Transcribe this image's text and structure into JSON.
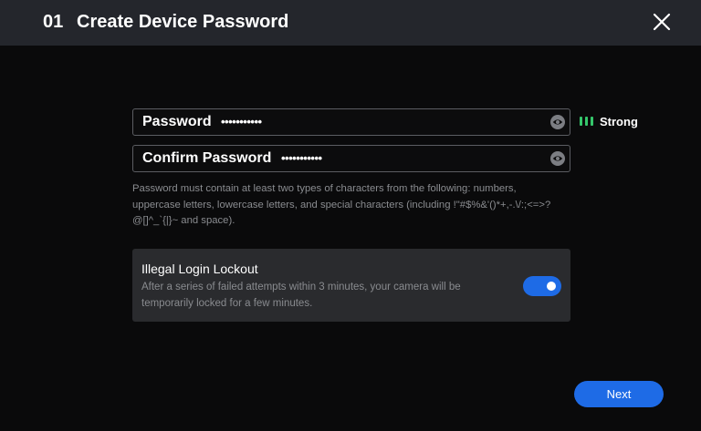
{
  "header": {
    "step": "01",
    "title": "Create Device Password",
    "close_icon": "close-icon"
  },
  "password_field": {
    "label": "Password",
    "value": "•••••••••••",
    "icon": "eye-icon"
  },
  "confirm_field": {
    "label": "Confirm Password",
    "value": "•••••••••••",
    "icon": "eye-icon"
  },
  "strength": {
    "label": "Strong",
    "bars_filled": 3,
    "bars_total": 3,
    "color": "#35c66b"
  },
  "hint": "Password must contain at least two types of characters from the following: numbers, uppercase letters, lowercase letters, and special characters (including !\"#$%&'()*+,-.\\/:;<=>?@[]^_`{|}~ and space).",
  "lockout": {
    "title": "Illegal Login Lockout",
    "description": "After a series of failed attempts within 3 minutes, your camera will be temporarily locked for a few minutes.",
    "enabled": true
  },
  "next_label": "Next",
  "colors": {
    "accent": "#1e6be6",
    "header_bg": "#24262c",
    "body_bg": "#0a0a0b",
    "panel_bg": "#2a2b2e"
  }
}
